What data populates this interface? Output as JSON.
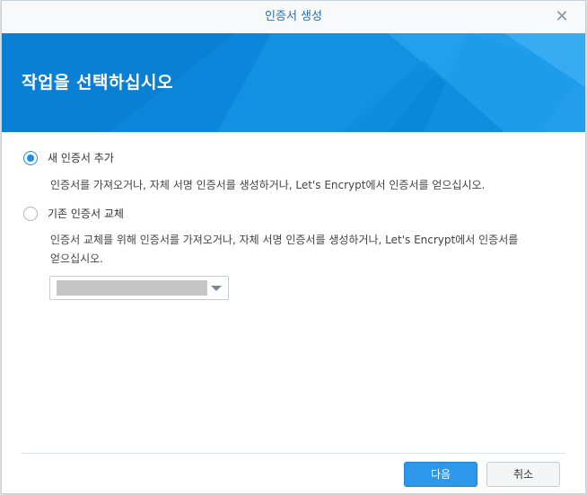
{
  "dialog": {
    "title": "인증서 생성",
    "close_icon": "close-icon"
  },
  "banner": {
    "title": "작업을 선택하십시오",
    "color": "#0e8bde"
  },
  "options": [
    {
      "label": "새 인증서 추가",
      "checked": true,
      "description": "인증서를 가져오거나, 자체 서명 인증서를 생성하거나, Let's Encrypt에서 인증서를 얻으십시오."
    },
    {
      "label": "기존 인증서 교체",
      "checked": false,
      "description_line1": "인증서 교체를 위해 인증서를 가져오거나, 자체 서명 인증서를 생성하거나, Let's Encrypt에서 인증서를",
      "description_line2": "얻으십시오."
    }
  ],
  "buttons": {
    "next": "다음",
    "cancel": "취소"
  },
  "accent_color": "#1d8ee8"
}
